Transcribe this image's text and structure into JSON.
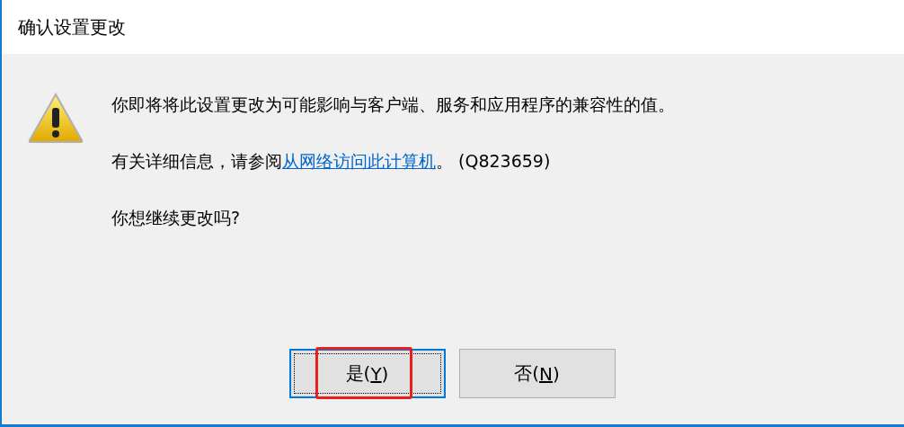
{
  "window": {
    "title": "确认设置更改"
  },
  "message": {
    "lines": [
      {
        "kind": "text",
        "text": "你即将将此设置更改为可能影响与客户端、服务和应用程序的兼容性的值。"
      },
      {
        "kind": "link",
        "before": "有关详细信息，请参阅",
        "link": "从网络访问此计算机",
        "after": "。 (Q823659)"
      },
      {
        "kind": "text",
        "text": "你想继续更改吗?"
      }
    ]
  },
  "buttons": [
    {
      "before": "是(",
      "mnemonic": "Y",
      "after": ")",
      "default": true,
      "highlighted": true
    },
    {
      "before": "否(",
      "mnemonic": "N",
      "after": ")",
      "default": false,
      "highlighted": false
    }
  ]
}
